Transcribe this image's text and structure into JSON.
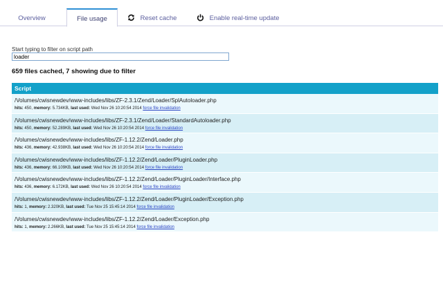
{
  "tabs": [
    {
      "label": "Overview",
      "icon": ""
    },
    {
      "label": "File usage",
      "icon": ""
    },
    {
      "label": "Reset cache",
      "icon": "refresh-icon"
    },
    {
      "label": "Enable real-time update",
      "icon": "power-icon"
    }
  ],
  "filter": {
    "label": "Start typing to filter on script path",
    "value": "loader"
  },
  "summary": "659 files cached, 7 showing due to filter",
  "table": {
    "header": "Script",
    "labels": {
      "hits": "hits:",
      "memory": "memory:",
      "last_used": "last used:",
      "invalidate": "force file invalidation"
    },
    "rows": [
      {
        "path": "/Volumes/cwisnewdev/www-includes/libs/ZF-2.3.1/Zend/Loader/SplAutoloader.php",
        "hits": "450",
        "memory": "5.734KB",
        "last_used": "Wed Nov 26 10:20:54 2014"
      },
      {
        "path": "/Volumes/cwisnewdev/www-includes/libs/ZF-2.3.1/Zend/Loader/StandardAutoloader.php",
        "hits": "450",
        "memory": "52.289KB",
        "last_used": "Wed Nov 26 10:20:54 2014"
      },
      {
        "path": "/Volumes/cwisnewdev/www-includes/libs/ZF-1.12.2/Zend/Loader.php",
        "hits": "436",
        "memory": "42.938KB",
        "last_used": "Wed Nov 26 10:20:54 2014"
      },
      {
        "path": "/Volumes/cwisnewdev/www-includes/libs/ZF-1.12.2/Zend/Loader/PluginLoader.php",
        "hits": "436",
        "memory": "66.109KB",
        "last_used": "Wed Nov 26 10:20:54 2014"
      },
      {
        "path": "/Volumes/cwisnewdev/www-includes/libs/ZF-1.12.2/Zend/Loader/PluginLoader/Interface.php",
        "hits": "436",
        "memory": "6.172KB",
        "last_used": "Wed Nov 26 10:20:54 2014"
      },
      {
        "path": "/Volumes/cwisnewdev/www-includes/libs/ZF-1.12.2/Zend/Loader/PluginLoader/Exception.php",
        "hits": "1",
        "memory": "2.320KB",
        "last_used": "Tue Nov 25 15:45:14 2014"
      },
      {
        "path": "/Volumes/cwisnewdev/www-includes/libs/ZF-1.12.2/Zend/Loader/Exception.php",
        "hits": "1",
        "memory": "2.266KB",
        "last_used": "Tue Nov 25 15:45:14 2014"
      }
    ]
  }
}
